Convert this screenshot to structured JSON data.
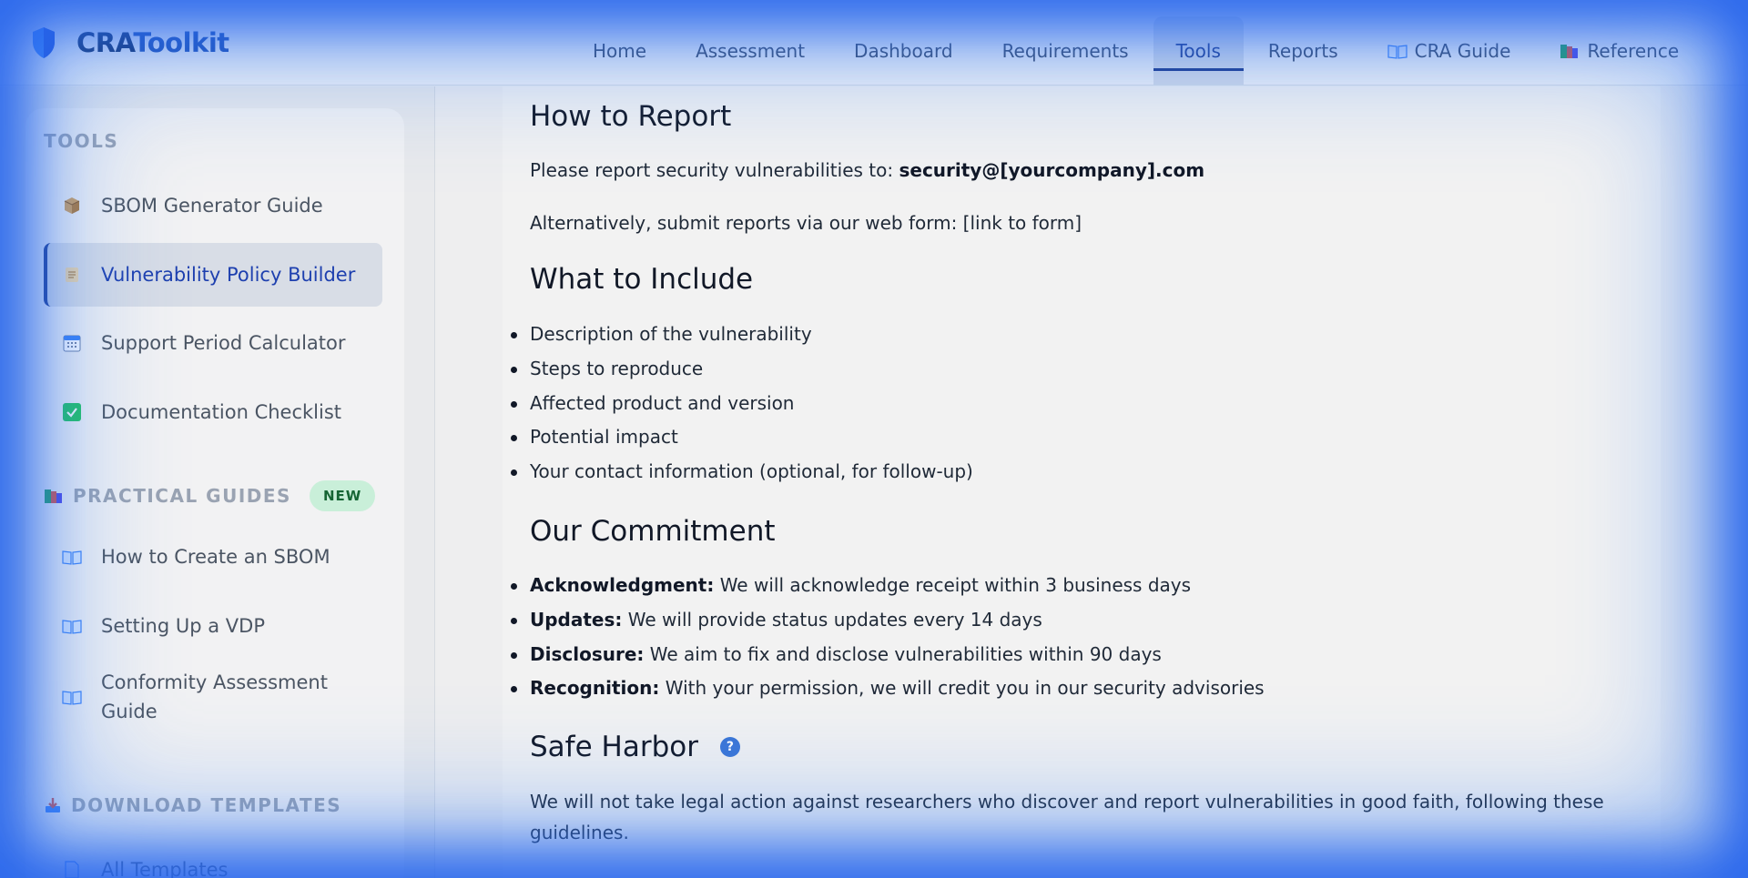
{
  "brand": {
    "prefix": "CRA",
    "suffix": "Toolkit"
  },
  "nav": {
    "items": [
      {
        "label": "Home"
      },
      {
        "label": "Assessment"
      },
      {
        "label": "Dashboard"
      },
      {
        "label": "Requirements"
      },
      {
        "label": "Tools",
        "active": true
      },
      {
        "label": "Reports"
      },
      {
        "label": "CRA Guide",
        "icon": "open-book-icon"
      },
      {
        "label": "Reference",
        "icon": "books-icon"
      }
    ]
  },
  "sidebar": {
    "tools_title": "TOOLS",
    "tools": [
      {
        "label": "SBOM Generator Guide",
        "icon": "package-icon"
      },
      {
        "label": "Vulnerability Policy Builder",
        "icon": "scroll-icon",
        "active": true
      },
      {
        "label": "Support Period Calculator",
        "icon": "calendar-icon"
      },
      {
        "label": "Documentation Checklist",
        "icon": "checkbox-icon"
      }
    ],
    "guides_title": "PRACTICAL GUIDES",
    "guides_badge": "NEW",
    "guides": [
      {
        "label": "How to Create an SBOM",
        "icon": "open-book-icon"
      },
      {
        "label": "Setting Up a VDP",
        "icon": "open-book-icon"
      },
      {
        "label": "Conformity Assessment Guide",
        "icon": "open-book-icon"
      }
    ],
    "downloads_title": "DOWNLOAD TEMPLATES",
    "downloads": [
      {
        "label": "All Templates",
        "icon": "document-icon"
      }
    ]
  },
  "content": {
    "report": {
      "heading": "How to Report",
      "email_prefix": "Please report security vulnerabilities to: ",
      "email": "security@[yourcompany].com",
      "alt": "Alternatively, submit reports via our web form: [link to form]"
    },
    "include": {
      "heading": "What to Include",
      "items": [
        "Description of the vulnerability",
        "Steps to reproduce",
        "Affected product and version",
        "Potential impact",
        "Your contact information (optional, for follow-up)"
      ]
    },
    "commitment": {
      "heading": "Our Commitment",
      "items": [
        {
          "term": "Acknowledgment:",
          "text": " We will acknowledge receipt within 3 business days"
        },
        {
          "term": "Updates:",
          "text": " We will provide status updates every 14 days"
        },
        {
          "term": "Disclosure:",
          "text": " We aim to fix and disclose vulnerabilities within 90 days"
        },
        {
          "term": "Recognition:",
          "text": " With your permission, we will credit you in our security advisories"
        }
      ]
    },
    "safe_harbor": {
      "heading": "Safe Harbor",
      "help": "?",
      "text": "We will not take legal action against researchers who discover and report vulnerabilities in good faith, following these guidelines."
    }
  },
  "colors": {
    "brand_dark": "#0f2a5c",
    "brand_accent": "#1e4fb3",
    "active_nav": "#1e3a8a",
    "badge_bg": "#c9efd9",
    "vignette": "#2563eb"
  }
}
